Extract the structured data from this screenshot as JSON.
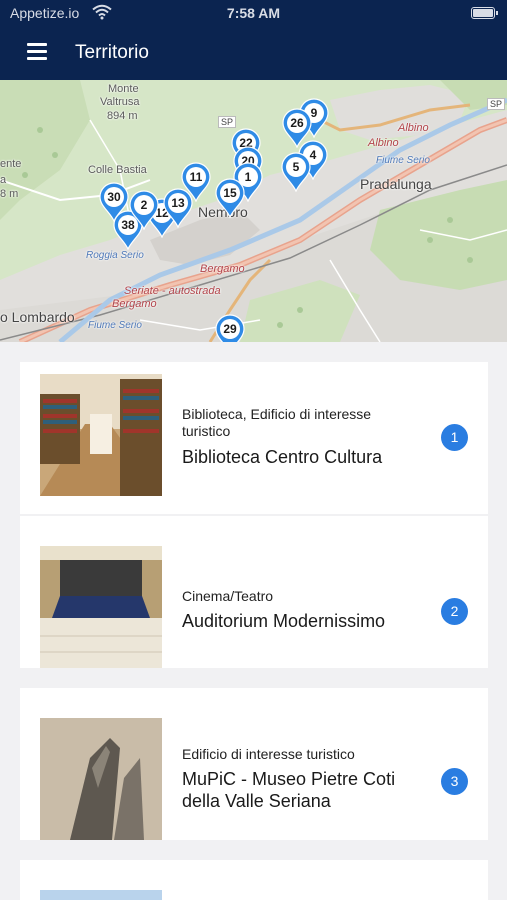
{
  "status_bar": {
    "carrier": "Appetize.io",
    "time": "7:58 AM"
  },
  "header": {
    "title": "Territorio"
  },
  "map": {
    "labels": {
      "monte": "Monte",
      "valtrusa": "Valtrusa",
      "elevation": "894 m",
      "colle_bastia": "Colle Bastia",
      "sp": "SP",
      "sp_right": "SP",
      "albino": "Albino",
      "albino_river": "Albino",
      "fiume_serio": "Fiume Serio",
      "pradalunga": "Pradalunga",
      "nembro": "Nembro",
      "bergamo_road": "Bergamo",
      "seriate_road": "Seriate - autostrada",
      "bergamo_road2": "Bergamo",
      "roggia": "Roggia Serio",
      "lombardo": "o Lombardo",
      "fiume_serio2": "Fiume Serio",
      "left_ente": "ente",
      "left_a": "a",
      "left_m": "8 m"
    },
    "pins": [
      "9",
      "26",
      "22",
      "20",
      "4",
      "5",
      "1",
      "15",
      "11",
      "12",
      "30",
      "38",
      "2",
      "13",
      "29"
    ]
  },
  "places": [
    {
      "category": "Biblioteca, Edificio di interesse turistico",
      "name": "Biblioteca Centro Cultura",
      "number": "1"
    },
    {
      "category": "Cinema/Teatro",
      "name": "Auditorium Modernissimo",
      "number": "2"
    },
    {
      "category": "Edificio di interesse turistico",
      "name": "MuPiC - Museo Pietre Coti della Valle Seriana",
      "number": "3"
    }
  ]
}
